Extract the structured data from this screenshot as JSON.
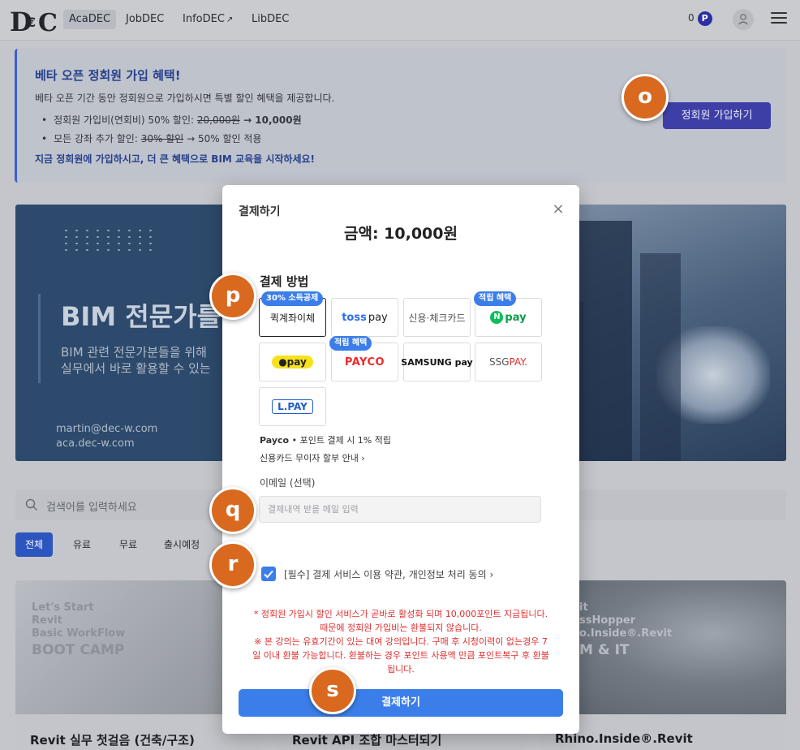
{
  "nav": {
    "logo_text": "DEC",
    "items": [
      {
        "label": "AcaDEC",
        "active": true
      },
      {
        "label": "JobDEC"
      },
      {
        "label": "InfoDEC",
        "external": true
      },
      {
        "label": "LibDEC"
      }
    ],
    "points_value": "0",
    "points_badge": "P",
    "icons": [
      "external-link-icon",
      "user-icon",
      "hamburger-menu-icon"
    ]
  },
  "banner": {
    "title": "베타 오픈 정회원 가입 혜택!",
    "subtitle": "베타 오픈 기간 동안 정회원으로 가입하시면 특별 할인 혜택을 제공합니다.",
    "bullet1_prefix": "정회원 가입비(연회비) 50% 할인: ",
    "bullet1_old": "20,000원",
    "bullet1_new": " → 10,000원",
    "bullet2_prefix": "모든 강좌 추가 할인: ",
    "bullet2_old": "30% 할인",
    "bullet2_new": " → 50% 할인 적용",
    "cta_text": "지금 정회원에 가입하시고, 더 큰 혜택으로 BIM 교육을 시작하세요!",
    "join_button": "정회원 가입하기"
  },
  "hero": {
    "title": "BIM 전문가를",
    "desc_line1": "BIM 관련 전문가분들을 위해",
    "desc_line2": "실무에서 바로 활용할 수 있는",
    "contact_email": "martin@dec-w.com",
    "contact_site": "aca.dec-w.com"
  },
  "search": {
    "placeholder": "검색어를 입력하세요"
  },
  "filters": [
    "전체",
    "유료",
    "무료",
    "출시예정"
  ],
  "cards": [
    {
      "title": "Revit 실무 첫걸음 (건축/구조)",
      "overlay_line1": "Let's Start",
      "overlay_line2": "Revit",
      "overlay_line3": "Basic WorkFlow",
      "overlay_line4": "BOOT CAMP"
    },
    {
      "title": "Revit API 조합 마스터되기"
    },
    {
      "title": "Rhino.Inside®.Revit",
      "overlay_line1": "it",
      "overlay_line2": "ssHopper",
      "overlay_line3": "o.Inside®.Revit",
      "overlay_line4": "M & IT"
    }
  ],
  "modal": {
    "header": "결제하기",
    "close_symbol": "×",
    "amount": "금액: 10,000원",
    "method_title": "결제 방법",
    "methods": [
      {
        "key": "quick",
        "label": "퀵계좌이체",
        "tag": "30% 소득공제",
        "selected": true
      },
      {
        "key": "toss",
        "label_a": "toss",
        "label_b": "pay"
      },
      {
        "key": "card",
        "label": "신용·체크카드"
      },
      {
        "key": "npay",
        "n": "N",
        "label": "pay",
        "tag": "적립 혜택"
      },
      {
        "key": "kakao",
        "label": "●pay"
      },
      {
        "key": "payco",
        "label": "PAYCO",
        "tag": "적립 혜택"
      },
      {
        "key": "samsung",
        "label": "SAMSUNG pay"
      },
      {
        "key": "ssg",
        "label_a": "SSG",
        "label_b": "PAY."
      },
      {
        "key": "lpay",
        "label": "L.PAY"
      }
    ],
    "payco_note_bold": "Payco",
    "payco_note": " • 포인트 결제 시 1% 적립",
    "card_guide": "신용카드 무이자 할부 안내 ›",
    "email_label": "이메일 (선택)",
    "email_placeholder": "결제내역 받을 메일 입력",
    "agree_text": "[필수] 결제 서비스 이용 약관, 개인정보 처리 동의 ›",
    "notice_line1": "* 정회원 가입시 할인 서비스가 곧바로 활성화 되며 10,000포인트 지급됩니다.",
    "notice_line2": "때문에 정회원 가입비는 환불되지 않습니다.",
    "notice_line3": "※ 본 강의는 유효기간이 있는 대여 강의입니다. 구매 후 시청이력이 없는경우 7",
    "notice_line4": "일 이내 환불 가능합니다. 환불하는 경우 포인트 사용액 만큼 포인트복구 후 환불",
    "notice_line5": "됩니다.",
    "pay_button": "결제하기"
  },
  "markers": [
    "o",
    "p",
    "q",
    "r",
    "s"
  ],
  "colors": {
    "accent": "#3b7ee9",
    "brand_dark": "#3e3fa6",
    "marker": "#d9691f",
    "notice": "#e02f2f"
  }
}
